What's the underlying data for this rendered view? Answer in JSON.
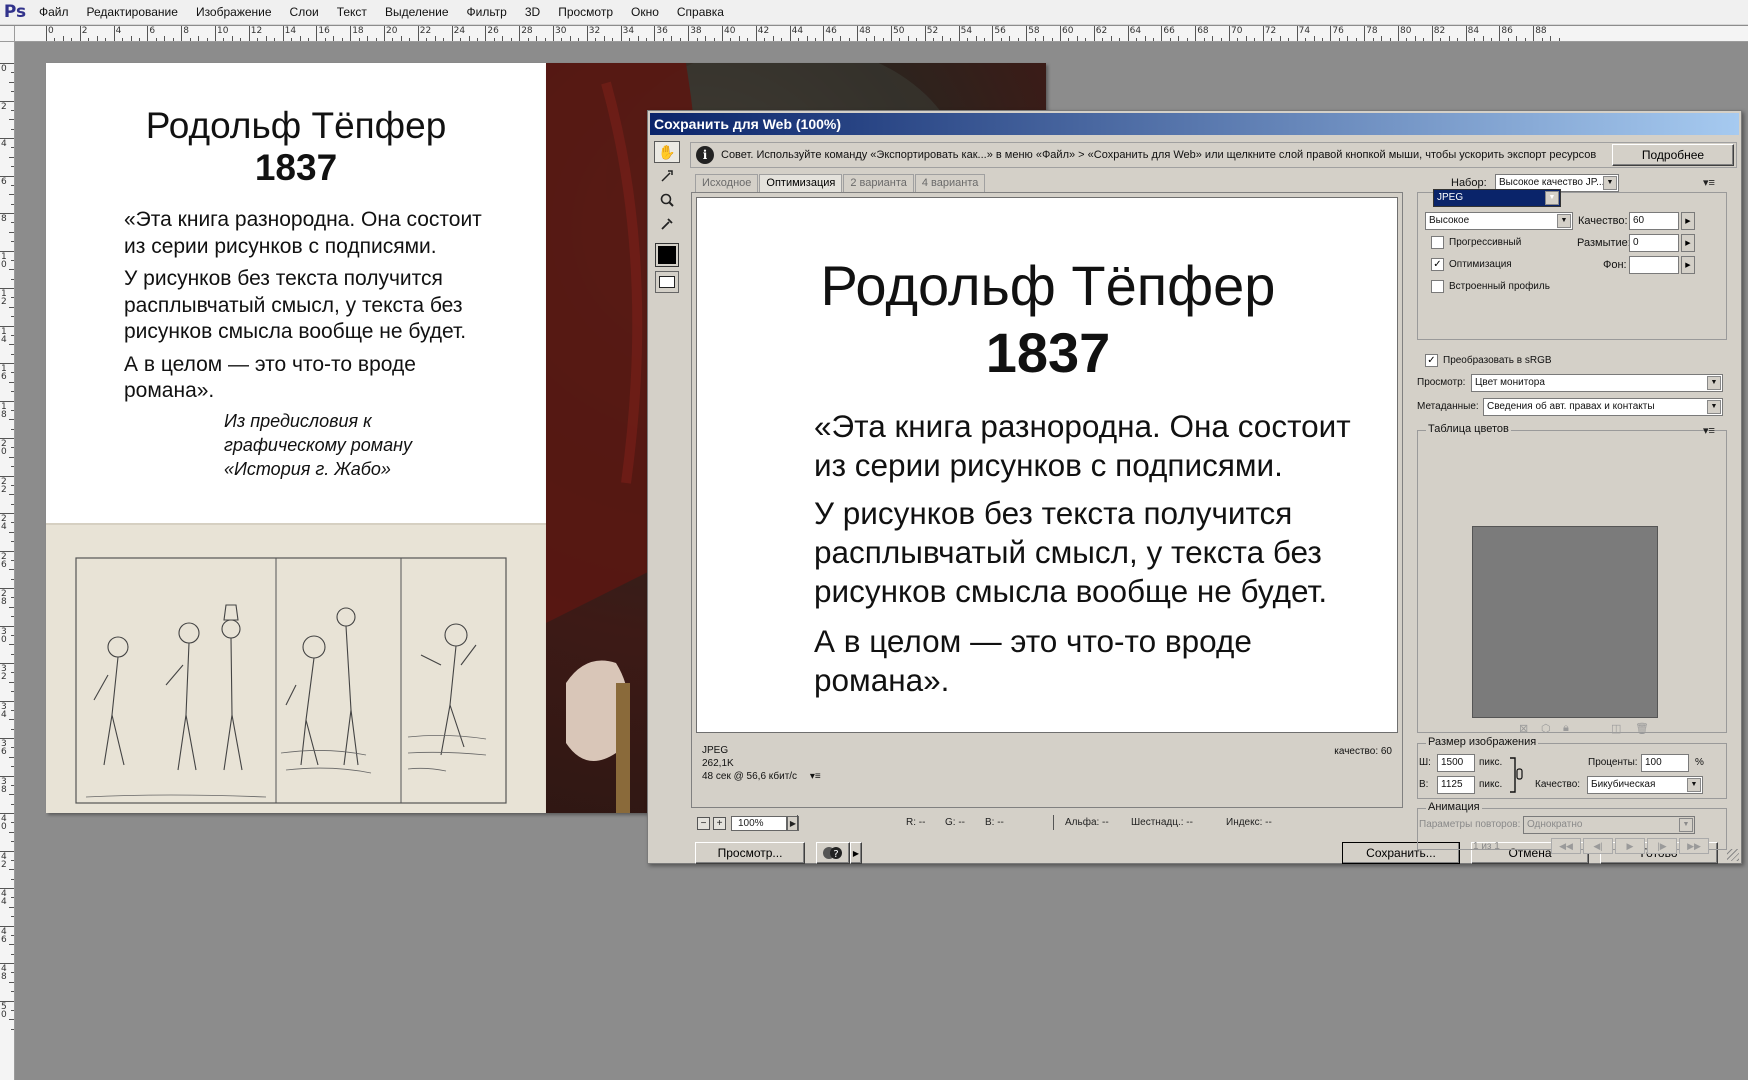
{
  "app": {
    "logo": "Ps",
    "menu": [
      "Файл",
      "Редактирование",
      "Изображение",
      "Слои",
      "Текст",
      "Выделение",
      "Фильтр",
      "3D",
      "Просмотр",
      "Окно",
      "Справка"
    ]
  },
  "ruler": {
    "top_labels": [
      "0",
      "2",
      "4",
      "6",
      "8",
      "10",
      "12",
      "14",
      "16",
      "18",
      "20",
      "22",
      "24",
      "26",
      "28",
      "30",
      "32",
      "34",
      "36",
      "38",
      "40",
      "42",
      "44",
      "46",
      "48",
      "50",
      "52",
      "54",
      "56",
      "58",
      "60",
      "62",
      "64",
      "66",
      "68",
      "70",
      "72",
      "74",
      "76",
      "78",
      "80",
      "82",
      "84",
      "86",
      "88"
    ],
    "left_labels": [
      "0",
      "2",
      "4",
      "6",
      "8",
      "10",
      "12",
      "14",
      "16",
      "18",
      "20",
      "22",
      "24",
      "26",
      "28",
      "30",
      "32",
      "34",
      "36",
      "38",
      "40",
      "42",
      "44",
      "46",
      "48",
      "50"
    ]
  },
  "document": {
    "title": "Родольф Тёпфер",
    "year": "1837",
    "quote": [
      "«Эта книга разнородна. Она состоит",
      "из серии рисунков с подписями.",
      "У рисунков без текста получится",
      "расплывчатый смысл, у текста без",
      "рисунков смысла вообще не будет.",
      "А в целом — это что-то вроде",
      "романа»."
    ],
    "source": [
      "Из предисловия к",
      "графическому роману",
      "«История г. Жабо»"
    ]
  },
  "dialog": {
    "title": "Сохранить для Web (100%)",
    "tip": "Совет. Используйте команду «Экспортировать как...» в меню «Файл» > «Сохранить для Web» или щелкните слой правой кнопкой мыши, чтобы ускорить экспорт ресурсов",
    "more_label": "Подробнее",
    "tabs": [
      "Исходное",
      "Оптимизация",
      "2 варианта",
      "4 варианта"
    ],
    "preview_info": {
      "format": "JPEG",
      "size": "262,1K",
      "time": "48 сек @ 56,6 кбит/с",
      "menu": "▾≡",
      "quality": "качество: 60"
    },
    "status": {
      "zoom": "100%",
      "r": "R: --",
      "g": "G: --",
      "b": "B: --",
      "alpha": "Альфа: --",
      "hex": "Шестнадц.: --",
      "index": "Индекс: --"
    },
    "buttons": {
      "preview": "Просмотр...",
      "save": "Сохранить...",
      "cancel": "Отмена",
      "done": "Готово"
    },
    "settings": {
      "preset_label": "Набор:",
      "preset_value": "Высокое качество JP...",
      "format": "JPEG",
      "quality_preset": "Высокое",
      "quality_label": "Качество:",
      "quality_value": "60",
      "blur_label": "Размытие:",
      "blur_value": "0",
      "matte_label": "Фон:",
      "progressive": "Прогрессивный",
      "optimized": "Оптимизация",
      "embed_profile": "Встроенный профиль",
      "convert_srgb": "Преобразовать в sRGB",
      "preview_label": "Просмотр:",
      "preview_value": "Цвет монитора",
      "metadata_label": "Метаданные:",
      "metadata_value": "Сведения об авт. правах и контакты",
      "color_table_title": "Таблица цветов",
      "image_size_title": "Размер изображения",
      "width_label": "Ш:",
      "width_value": "1500",
      "height_label": "В:",
      "height_value": "1125",
      "px_label": "пикс.",
      "percent_label": "Проценты:",
      "percent_value": "100",
      "percent_sign": "%",
      "resample_label": "Качество:",
      "resample_value": "Бикубическая",
      "animation_title": "Анимация",
      "loop_label": "Параметры повторов:",
      "loop_value": "Однократно",
      "frame_counter": "1 из 1"
    }
  },
  "colors": {
    "canvas_bg": "#8c8c8c",
    "dialog_bg": "#d4d0c8",
    "titlebar_start": "#0a246a",
    "titlebar_end": "#a6caf0",
    "color_table_bg": "#7b7b7b"
  }
}
